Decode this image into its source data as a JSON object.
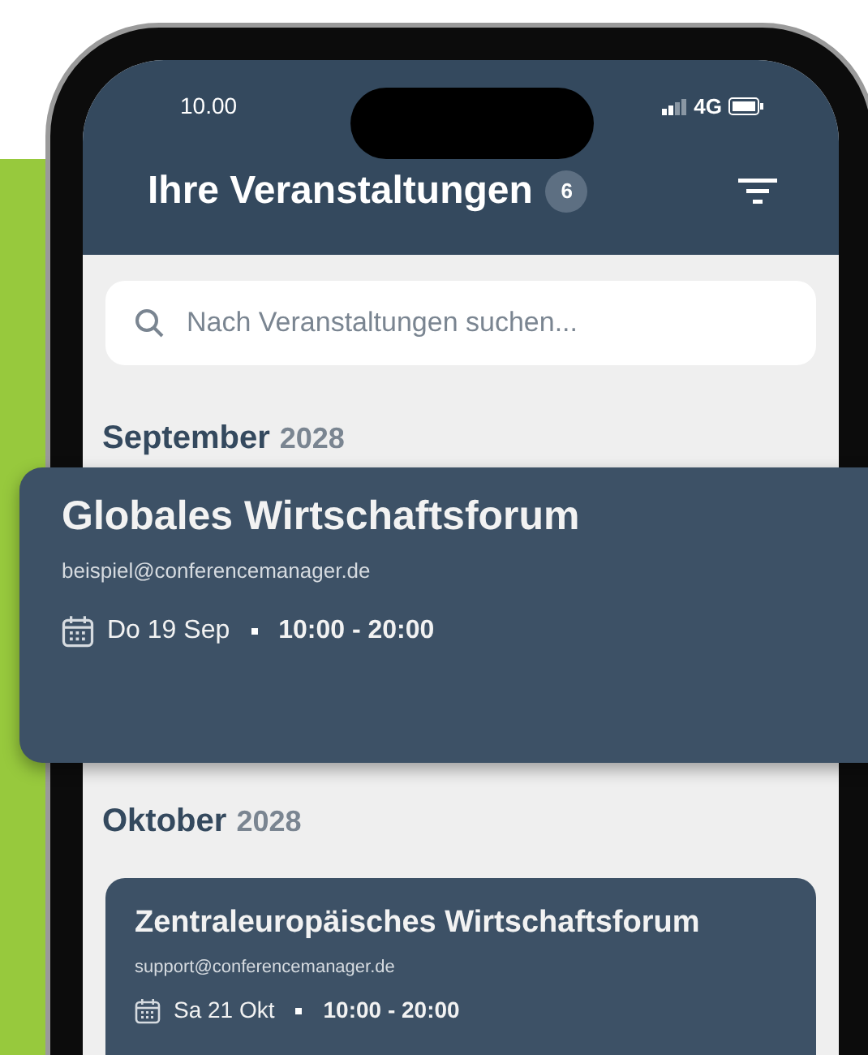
{
  "status_bar": {
    "time": "10.00",
    "network": "4G"
  },
  "header": {
    "title": "Ihre Veranstaltungen",
    "count": "6"
  },
  "search": {
    "placeholder": "Nach Veranstaltungen suchen..."
  },
  "months": [
    {
      "month": "September",
      "year": "2028",
      "events": [
        {
          "kind": "popout",
          "title": "Globales Wirtschaftsforum",
          "email": "beispiel@conferencemanager.de",
          "date": "Do 19 Sep",
          "time": "10:00 - 20:00"
        }
      ]
    },
    {
      "month": "Oktober",
      "year": "2028",
      "events": [
        {
          "kind": "card",
          "title": "Zentraleuropäisches Wirtschaftsforum",
          "email": "support@conferencemanager.de",
          "date": "Sa 21 Okt",
          "time": "10:00 - 20:00"
        }
      ]
    }
  ]
}
